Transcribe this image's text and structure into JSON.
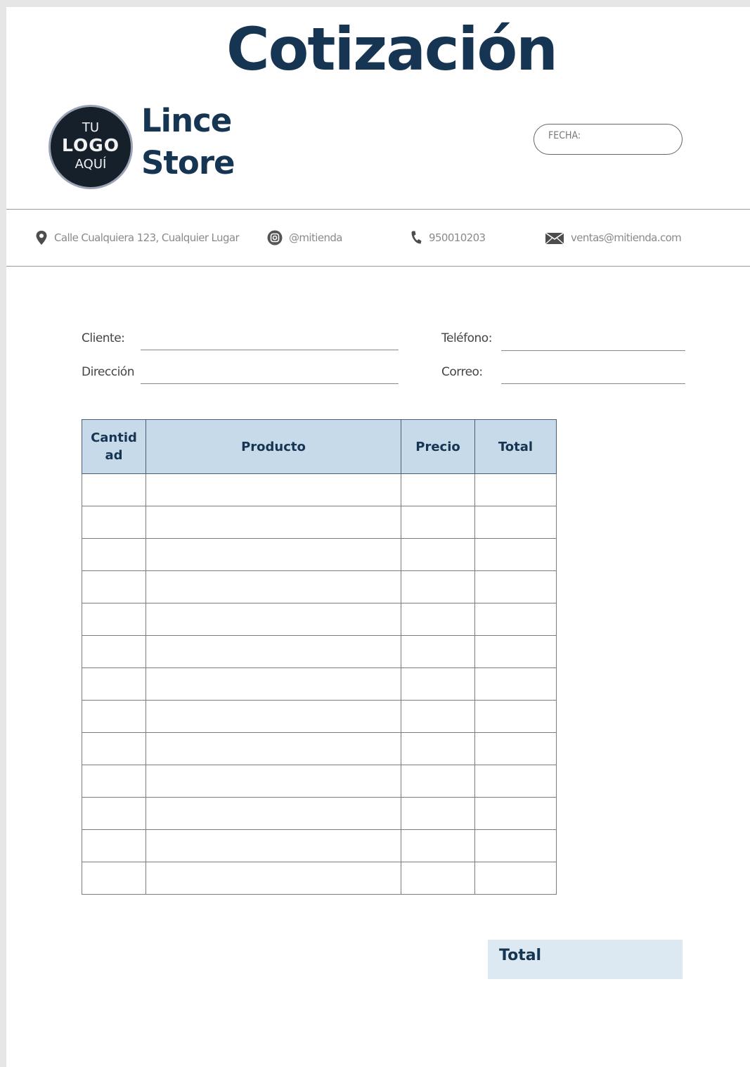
{
  "document": {
    "title": "Cotización"
  },
  "logo": {
    "line1": "TU",
    "line2": "LOGO",
    "line3": "AQUÍ"
  },
  "store": {
    "name_line1": "Lince",
    "name_line2": "Store"
  },
  "date": {
    "label": "FECHA:"
  },
  "contact": {
    "address": "Calle Cualquiera 123, Cualquier Lugar",
    "instagram": "@mitienda",
    "phone": "950010203",
    "email": "ventas@mitienda.com"
  },
  "client_fields": {
    "cliente": "Cliente:",
    "direccion": "Dirección",
    "telefono": "Teléfono:",
    "correo": "Correo:"
  },
  "table": {
    "columns": [
      "Cantid ad",
      "Producto",
      "Precio",
      "Total"
    ],
    "empty_rows": 13
  },
  "summary": {
    "total_label": "Total"
  },
  "colors": {
    "primary": "#163553",
    "header_fill": "#c7dae9",
    "total_fill": "#dce8f2"
  }
}
